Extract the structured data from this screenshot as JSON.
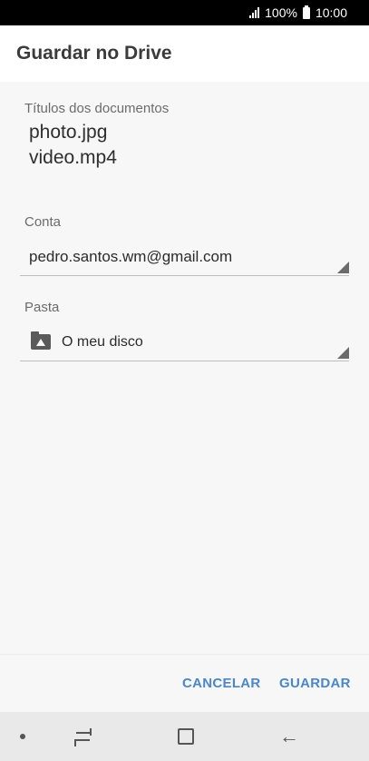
{
  "status_bar": {
    "battery_percent": "100%",
    "time": "10:00"
  },
  "header": {
    "title": "Guardar no Drive"
  },
  "documents": {
    "label": "Títulos dos documentos",
    "items": [
      "photo.jpg",
      "video.mp4"
    ]
  },
  "account": {
    "label": "Conta",
    "value": "pedro.santos.wm@gmail.com"
  },
  "folder": {
    "label": "Pasta",
    "value": "O meu disco",
    "icon": "drive-folder-icon"
  },
  "actions": {
    "cancel_label": "CANCELAR",
    "save_label": "GUARDAR",
    "accent_color": "#4a86c8"
  },
  "nav": {
    "icons": [
      "nav-dot-icon",
      "recent-apps-icon",
      "home-icon",
      "back-icon"
    ]
  }
}
